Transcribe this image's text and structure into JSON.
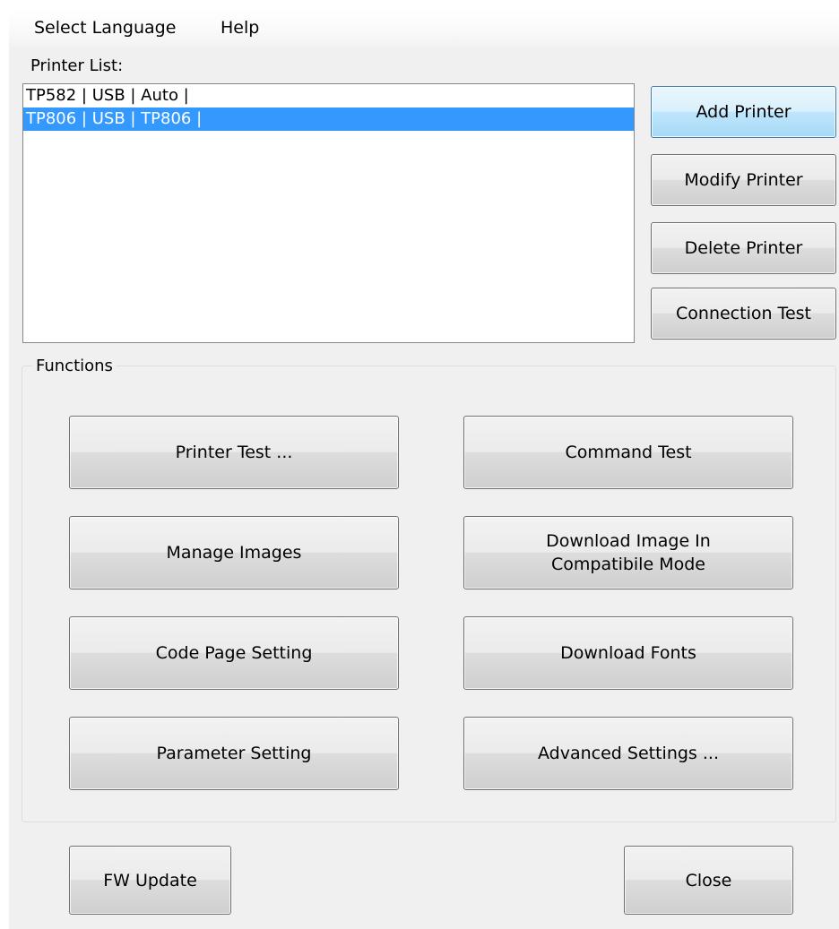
{
  "menu": {
    "items": [
      {
        "label": "Select Language"
      },
      {
        "label": "Help"
      }
    ]
  },
  "printer_list": {
    "label": "Printer List:",
    "rows": [
      {
        "text": "TP582 | USB | Auto |",
        "selected": false
      },
      {
        "text": "TP806 | USB | TP806 |",
        "selected": true
      }
    ],
    "selection_color": "#3399ff"
  },
  "printer_buttons": {
    "add": "Add Printer",
    "modify": "Modify Printer",
    "delete": "Delete Printer",
    "connection_test": "Connection Test"
  },
  "functions": {
    "title": "Functions",
    "buttons": {
      "printer_test": "Printer Test ...",
      "command_test": "Command Test",
      "manage_images": "Manage Images",
      "download_image_compatible": "Download Image In\nCompatibile Mode",
      "code_page_setting": "Code Page Setting",
      "download_fonts": "Download Fonts",
      "parameter_setting": "Parameter Setting",
      "advanced_settings": "Advanced Settings ..."
    }
  },
  "footer": {
    "fw_update": "FW Update",
    "close": "Close"
  }
}
